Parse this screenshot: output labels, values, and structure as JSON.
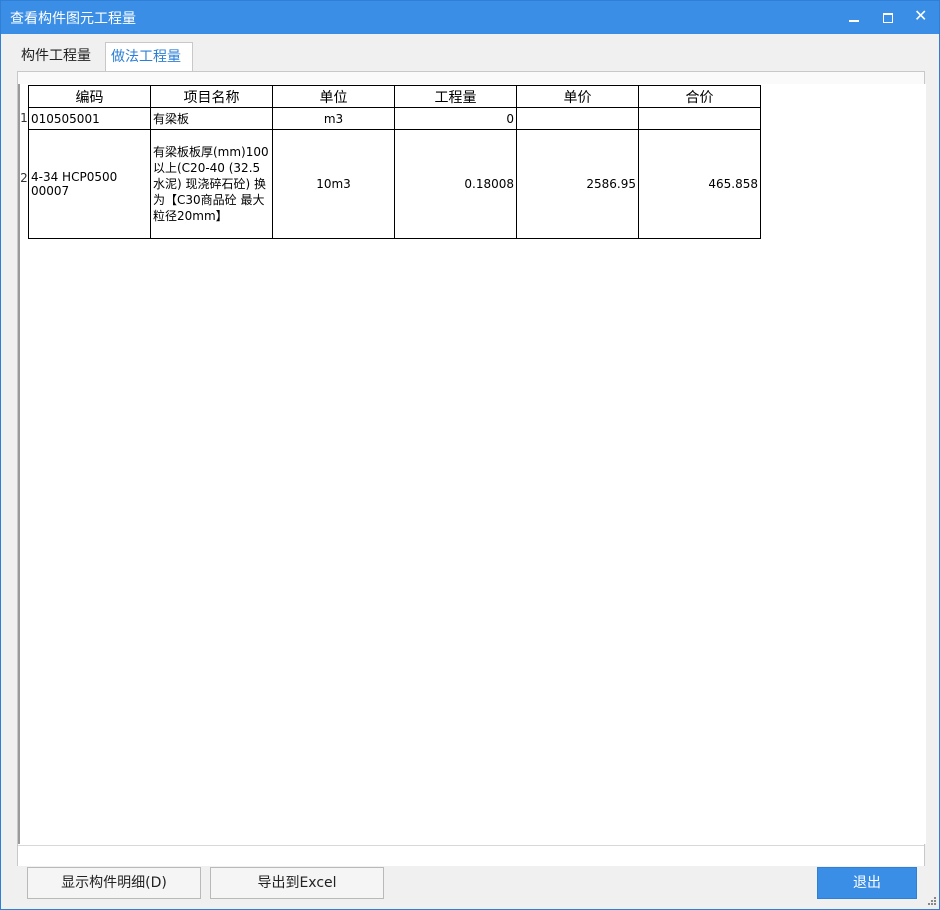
{
  "window": {
    "title": "查看构件图元工程量"
  },
  "tabs": [
    {
      "label": "构件工程量",
      "active": false
    },
    {
      "label": "做法工程量",
      "active": true
    }
  ],
  "table": {
    "columns": [
      "编码",
      "项目名称",
      "单位",
      "工程量",
      "单价",
      "合价"
    ],
    "rows": [
      {
        "index": "1",
        "code": "010505001",
        "name": "有梁板",
        "unit": "m3",
        "quantity": "0",
        "unit_price": "",
        "total_price": ""
      },
      {
        "index": "2",
        "code": "4-34 HCP0500 00007",
        "name": "有梁板板厚(mm)100以上(C20-40 (32.5水泥) 现浇碎石砼) 换为【C30商品砼 最大粒径20mm】",
        "unit": "10m3",
        "quantity": "0.18008",
        "unit_price": "2586.95",
        "total_price": "465.858"
      }
    ]
  },
  "buttons": {
    "show_detail": "显示构件明细(D)",
    "export_excel": "导出到Excel",
    "exit": "退出"
  },
  "colors": {
    "titlebar": "#3a8ee6",
    "active_tab_text": "#2c7fd6",
    "exit_button": "#3a8ee6"
  },
  "icons": {
    "minimize": "minimize-icon",
    "maximize": "maximize-icon",
    "close": "close-icon"
  }
}
